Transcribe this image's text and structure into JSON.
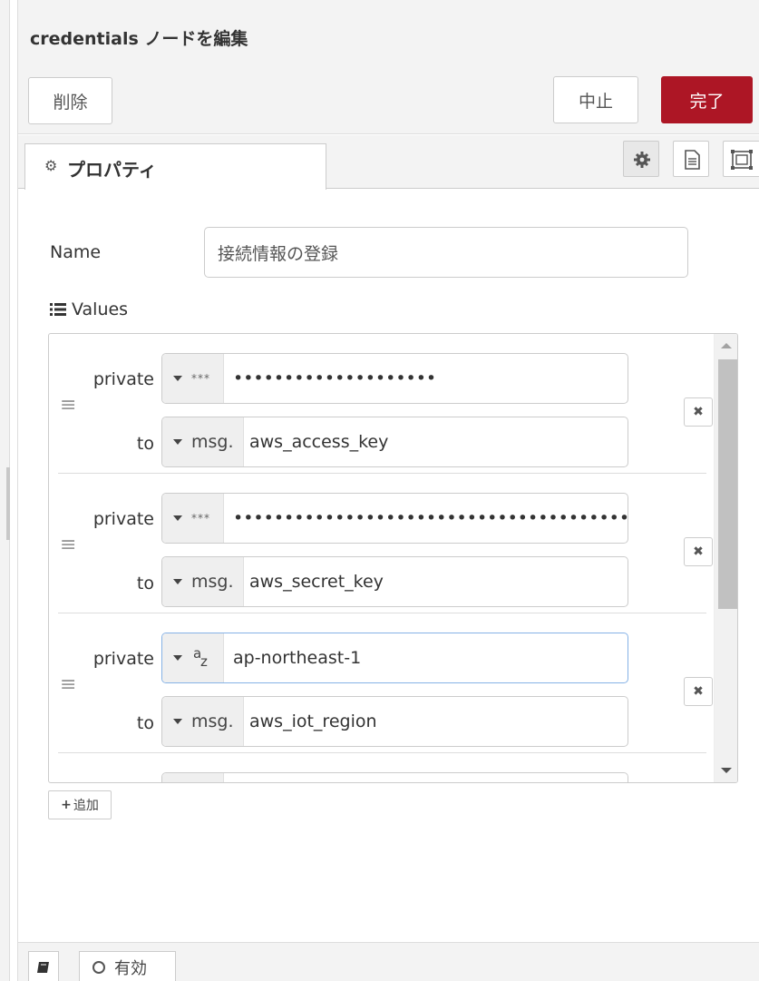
{
  "header": {
    "title": "credentials ノードを編集",
    "delete_label": "削除",
    "cancel_label": "中止",
    "done_label": "完了"
  },
  "tabs": {
    "properties_label": "プロパティ",
    "icons": [
      "settings-icon",
      "description-icon",
      "appearance-icon"
    ]
  },
  "form": {
    "name_label": "Name",
    "name_value": "接続情報の登録",
    "values_label": "Values",
    "add_label": "追加"
  },
  "rows": [
    {
      "private_label": "private",
      "private_type": "***",
      "private_value": "••••••••••••••••••••",
      "to_label": "to",
      "to_type": "msg.",
      "to_value": "aws_access_key"
    },
    {
      "private_label": "private",
      "private_type": "***",
      "private_value": "••••••••••••••••••••••••••••••••••••••••",
      "to_label": "to",
      "to_type": "msg.",
      "to_value": "aws_secret_key"
    },
    {
      "private_label": "private",
      "private_type": "az",
      "private_value": "ap-northeast-1",
      "to_label": "to",
      "to_type": "msg.",
      "to_value": "aws_iot_region"
    }
  ],
  "footer": {
    "enabled_label": "有効"
  },
  "colors": {
    "done_button": "#ad1625",
    "focus_border": "#85b2e6"
  }
}
